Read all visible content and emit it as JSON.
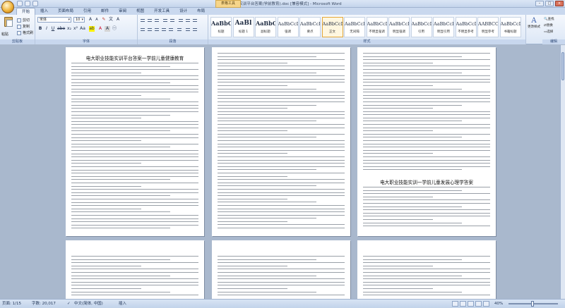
{
  "window": {
    "title": "职业技能实训平台答案(学前教育).doc [兼容模式] - Microsoft Word",
    "context_tab": "表格工具",
    "controls": [
      "–",
      "□",
      "×"
    ]
  },
  "tabs": [
    "开始",
    "插入",
    "页面布局",
    "引用",
    "邮件",
    "审阅",
    "视图",
    "开发工具",
    "设计",
    "布局"
  ],
  "active_tab": "开始",
  "ribbon": {
    "clipboard": {
      "label": "剪贴板",
      "paste": "粘贴",
      "cut": "剪切",
      "copy": "复制",
      "format_painter": "格式刷"
    },
    "font": {
      "label": "字体",
      "name": "宋体",
      "size": "10"
    },
    "paragraph": {
      "label": "段落"
    },
    "styles": {
      "label": "样式",
      "items": [
        {
          "sample": "AaBbC",
          "name": "标题"
        },
        {
          "sample": "AaBl",
          "name": "标题 1"
        },
        {
          "sample": "AaBbC",
          "name": "副标题"
        },
        {
          "sample": "AaBbCcDc",
          "name": "强调"
        },
        {
          "sample": "AaBbCcD",
          "name": "要点"
        },
        {
          "sample": "AaBbCcDc",
          "name": "正文"
        },
        {
          "sample": "AaBbCcDc",
          "name": "无间隔"
        },
        {
          "sample": "AaBbCcDc",
          "name": "不明显强调"
        },
        {
          "sample": "AaBbCcDc",
          "name": "明显强调"
        },
        {
          "sample": "AaBbCcDc",
          "name": "引用"
        },
        {
          "sample": "AaBbCcDc",
          "name": "明显引用"
        },
        {
          "sample": "AaBbCcDc",
          "name": "不明显参考"
        },
        {
          "sample": "AABBCCDI",
          "name": "明显参考"
        },
        {
          "sample": "AaBbCcD",
          "name": "书籍标题"
        }
      ],
      "selected_index": 5,
      "change_styles": "更改样式"
    },
    "editing": {
      "label": "编辑",
      "find": "查找",
      "replace": "替换",
      "select": "选择"
    }
  },
  "pages": [
    {
      "title": "电大职业技能实训平台答案一学前儿童健康教育"
    },
    {
      "title": ""
    },
    {
      "title": "电大职业技能实训一学前儿童发展心理学答案"
    },
    {
      "title": ""
    },
    {
      "title": ""
    },
    {
      "title": ""
    }
  ],
  "status": {
    "page": "页面: 1/15",
    "words": "字数: 20,017",
    "language": "中文(简体, 中国)",
    "mode": "插入",
    "zoom": "40%"
  }
}
